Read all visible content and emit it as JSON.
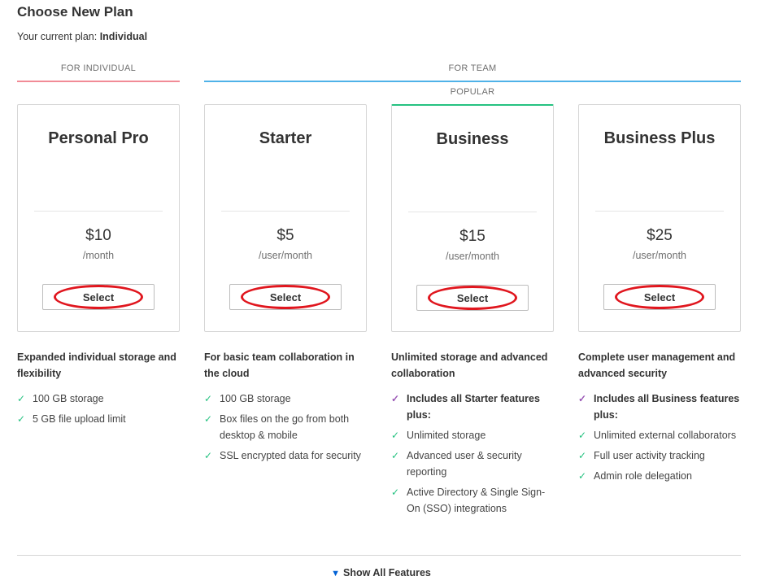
{
  "header": {
    "title": "Choose New Plan",
    "current_label": "Your current plan:",
    "current_value": "Individual"
  },
  "groups": {
    "individual_label": "FOR INDIVIDUAL",
    "individual_color": "#f18b96",
    "team_label": "FOR TEAM",
    "team_color": "#4fb2e8",
    "popular_label": "POPULAR",
    "popular_color": "#26c281"
  },
  "plans": [
    {
      "name": "Personal Pro",
      "price": "$10",
      "unit": "/month",
      "select_label": "Select",
      "description": "Expanded individual storage and flexibility",
      "features": [
        "100 GB storage",
        "5 GB file upload limit"
      ]
    },
    {
      "name": "Starter",
      "price": "$5",
      "unit": "/user/month",
      "select_label": "Select",
      "description": "For basic team collaboration in the cloud",
      "features": [
        "100 GB storage",
        "Box files on the go from both desktop & mobile",
        "SSL encrypted data for security"
      ]
    },
    {
      "name": "Business",
      "price": "$15",
      "unit": "/user/month",
      "select_label": "Select",
      "description": "Unlimited storage and advanced collaboration",
      "plus_feature": "Includes all Starter features plus:",
      "features": [
        "Unlimited storage",
        "Advanced user & security reporting",
        "Active Directory & Single Sign-On (SSO) integrations"
      ]
    },
    {
      "name": "Business Plus",
      "price": "$25",
      "unit": "/user/month",
      "select_label": "Select",
      "description": "Complete user management and advanced security",
      "plus_feature": "Includes all Business features plus:",
      "features": [
        "Unlimited external collaborators",
        "Full user activity tracking",
        "Admin role delegation"
      ]
    }
  ],
  "footer": {
    "show_all_label": "Show All Features"
  },
  "colors": {
    "check": "#26c281",
    "plus_check": "#9b59b6",
    "highlight": "#e0161e",
    "chevron": "#0061d5"
  },
  "icons": {
    "check": "check-icon",
    "chevron": "chevron-down-icon"
  }
}
